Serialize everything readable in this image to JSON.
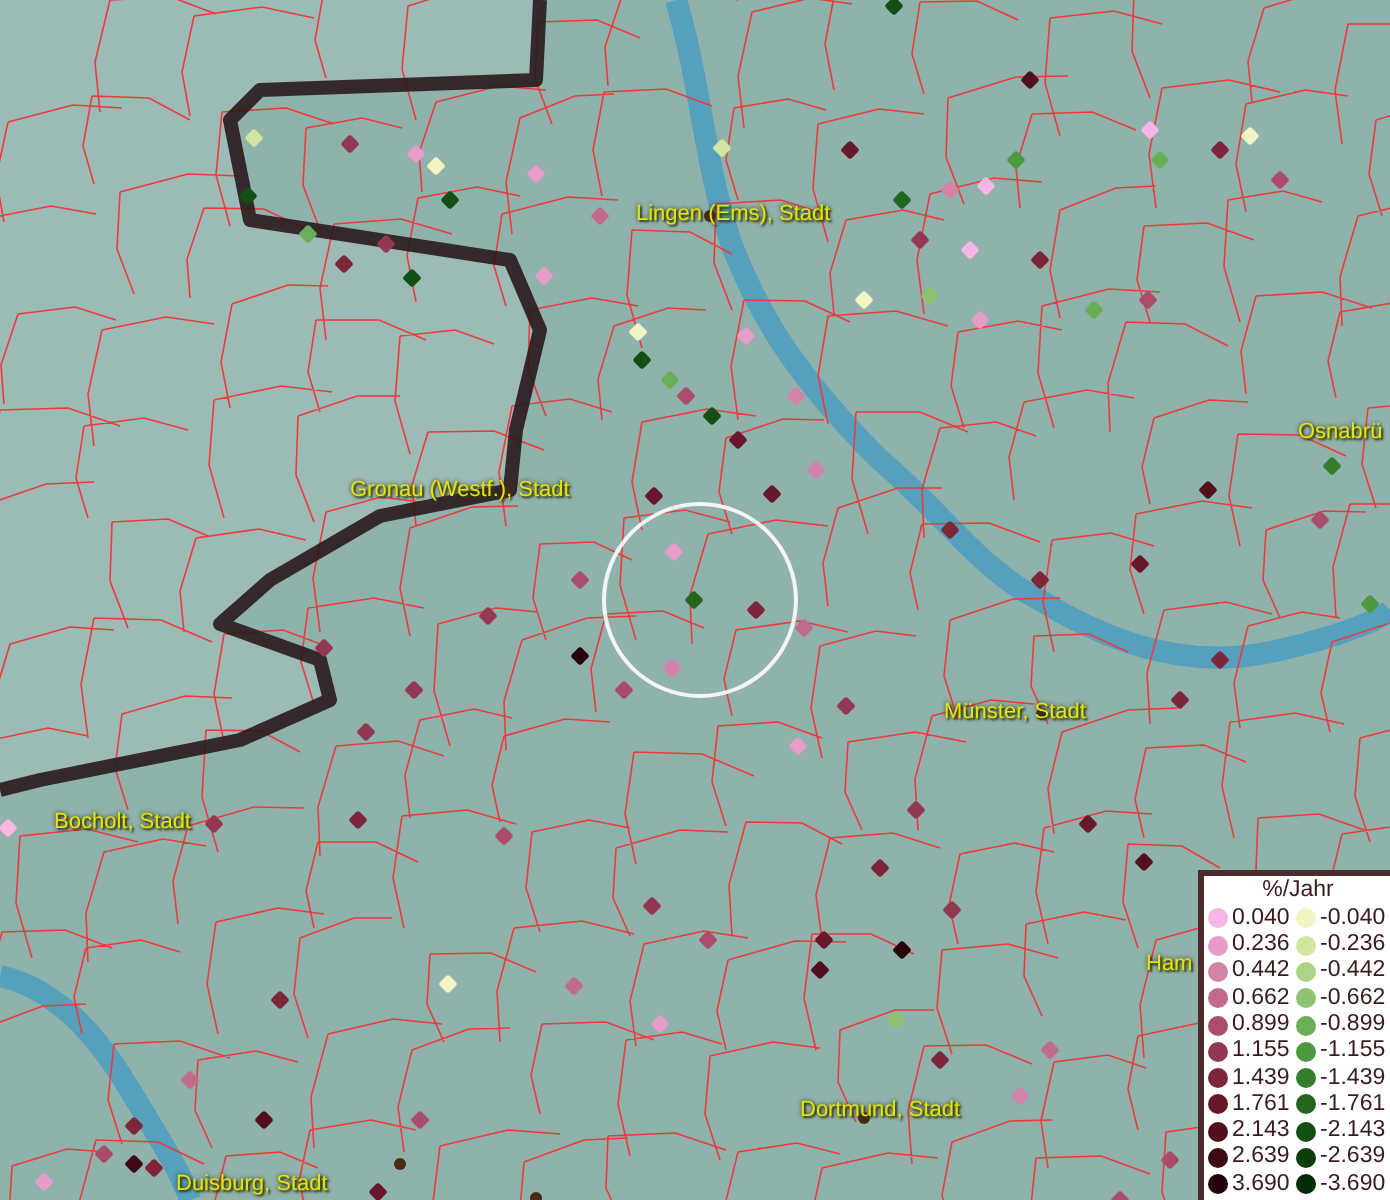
{
  "map": {
    "place_labels": [
      "Lingen (Ems), Stadt",
      "Osnabrü",
      "Gronau (Westf.), Stadt",
      "Münster, Stadt",
      "Bocholt, Stadt",
      "Ham",
      "Dortmund, Stadt",
      "Duisburg, Stadt"
    ]
  },
  "legend": {
    "title": "%/Jahr",
    "rows": [
      {
        "positive": {
          "label": "0.040",
          "color": "#f7b6e6"
        },
        "negative": {
          "label": "-0.040",
          "color": "#f2f5c2"
        }
      },
      {
        "positive": {
          "label": "0.236",
          "color": "#e59cc8"
        },
        "negative": {
          "label": "-0.236",
          "color": "#cfe5a0"
        }
      },
      {
        "positive": {
          "label": "0.442",
          "color": "#d483a8"
        },
        "negative": {
          "label": "-0.442",
          "color": "#acd486"
        }
      },
      {
        "positive": {
          "label": "0.662",
          "color": "#c26a8c"
        },
        "negative": {
          "label": "-0.662",
          "color": "#8cc270"
        }
      },
      {
        "positive": {
          "label": "0.899",
          "color": "#a94d6a"
        },
        "negative": {
          "label": "-0.899",
          "color": "#6aaf58"
        }
      },
      {
        "positive": {
          "label": "1.155",
          "color": "#933852"
        },
        "negative": {
          "label": "-1.155",
          "color": "#4c9a40"
        }
      },
      {
        "positive": {
          "label": "1.439",
          "color": "#7d263a"
        },
        "negative": {
          "label": "-1.439",
          "color": "#357f2c"
        }
      },
      {
        "positive": {
          "label": "1.761",
          "color": "#68182a"
        },
        "negative": {
          "label": "-1.761",
          "color": "#23661f"
        }
      },
      {
        "positive": {
          "label": "2.143",
          "color": "#52101c"
        },
        "negative": {
          "label": "-2.143",
          "color": "#124f14"
        }
      },
      {
        "positive": {
          "label": "2.639",
          "color": "#3c0811"
        },
        "negative": {
          "label": "-2.639",
          "color": "#083d0c"
        }
      },
      {
        "positive": {
          "label": "3.690",
          "color": "#250309"
        },
        "negative": {
          "label": "-3.690",
          "color": "#022a06"
        }
      }
    ]
  }
}
